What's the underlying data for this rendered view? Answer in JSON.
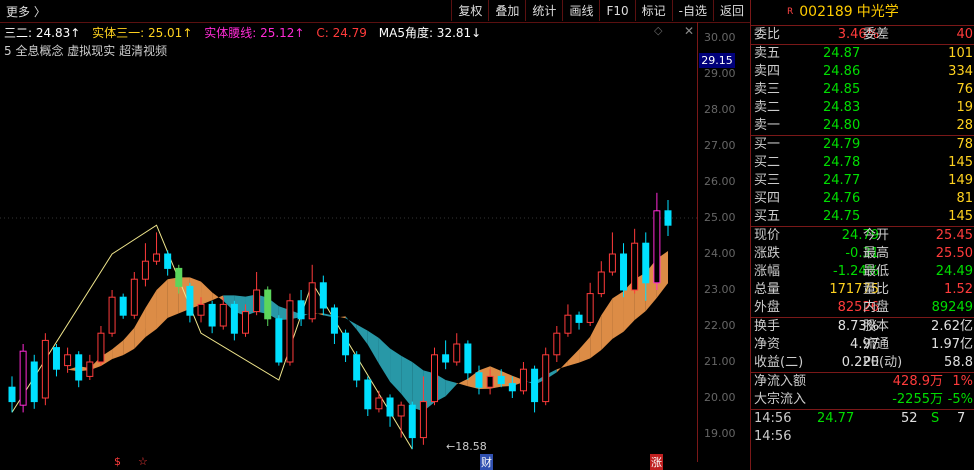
{
  "toolbar": {
    "more": "更多 〉",
    "buttons": [
      "复权",
      "叠加",
      "统计",
      "画线",
      "F10",
      "标记",
      "-自选",
      "返回"
    ]
  },
  "indicator": {
    "items": [
      {
        "text": "三二: 24.83↑",
        "color": "#ffffff"
      },
      {
        "text": "实体三一: 25.01↑",
        "color": "#ffd21f"
      },
      {
        "text": "实体腰线: 25.12↑",
        "color": "#ff2bd6"
      },
      {
        "text": "C: 24.79",
        "color": "#ff3b3b"
      },
      {
        "text": "MA5角度: 32.81↓",
        "color": "#ffffff"
      }
    ],
    "concepts": "5 全息概念 虚拟现实 超清视频"
  },
  "axis": {
    "ticks": [
      "30.00",
      "29.00",
      "28.00",
      "27.00",
      "26.00",
      "25.00",
      "24.00",
      "23.00",
      "22.00",
      "21.00",
      "20.00",
      "19.00"
    ],
    "current": "29.15"
  },
  "chart_data": {
    "type": "candlestick",
    "low_label": "←18.58",
    "markers": [
      "$",
      "☆",
      "财",
      "涨"
    ],
    "ylim": [
      18.4,
      30.4
    ],
    "candles": [
      [
        20.3,
        19.9,
        20.6,
        19.6
      ],
      [
        19.8,
        21.3,
        21.5,
        19.6
      ],
      [
        21.0,
        19.9,
        21.2,
        19.7
      ],
      [
        20.0,
        21.6,
        21.8,
        19.8
      ],
      [
        21.4,
        20.8,
        21.5,
        20.6
      ],
      [
        20.9,
        21.2,
        21.4,
        20.7
      ],
      [
        21.2,
        20.5,
        21.3,
        20.3
      ],
      [
        20.6,
        21.0,
        21.2,
        20.5
      ],
      [
        21.0,
        21.8,
        22.0,
        20.9
      ],
      [
        21.8,
        22.8,
        23.0,
        21.7
      ],
      [
        22.8,
        22.3,
        22.9,
        22.2
      ],
      [
        22.3,
        23.3,
        23.5,
        22.2
      ],
      [
        23.3,
        23.8,
        24.3,
        23.1
      ],
      [
        23.8,
        24.0,
        24.6,
        23.7
      ],
      [
        24.0,
        23.6,
        24.1,
        23.4
      ],
      [
        23.6,
        23.1,
        23.7,
        22.9
      ],
      [
        23.1,
        22.3,
        23.2,
        22.1
      ],
      [
        22.3,
        22.6,
        22.8,
        22.1
      ],
      [
        22.6,
        22.0,
        22.7,
        21.8
      ],
      [
        22.0,
        22.6,
        22.8,
        21.9
      ],
      [
        22.6,
        21.8,
        22.7,
        21.6
      ],
      [
        21.8,
        22.4,
        22.6,
        21.7
      ],
      [
        22.4,
        23.0,
        23.5,
        22.3
      ],
      [
        23.0,
        22.2,
        23.1,
        22.0
      ],
      [
        22.2,
        21.0,
        22.3,
        20.9
      ],
      [
        21.0,
        22.7,
        22.9,
        20.9
      ],
      [
        22.7,
        22.2,
        23.0,
        22.0
      ],
      [
        22.2,
        23.2,
        23.7,
        22.1
      ],
      [
        23.2,
        22.5,
        23.4,
        22.3
      ],
      [
        22.5,
        21.8,
        22.6,
        21.5
      ],
      [
        21.8,
        21.2,
        21.9,
        21.0
      ],
      [
        21.2,
        20.5,
        21.3,
        20.3
      ],
      [
        20.5,
        19.7,
        20.6,
        19.5
      ],
      [
        19.7,
        20.0,
        20.2,
        19.6
      ],
      [
        20.0,
        19.5,
        20.1,
        19.2
      ],
      [
        19.5,
        19.8,
        19.9,
        18.9
      ],
      [
        19.8,
        18.9,
        19.9,
        18.58
      ],
      [
        18.9,
        19.9,
        20.6,
        18.7
      ],
      [
        19.9,
        21.2,
        21.4,
        19.8
      ],
      [
        21.2,
        21.0,
        21.6,
        20.8
      ],
      [
        21.0,
        21.5,
        21.8,
        20.9
      ],
      [
        21.5,
        20.7,
        21.6,
        20.5
      ],
      [
        20.7,
        20.3,
        20.9,
        20.1
      ],
      [
        20.3,
        20.6,
        20.8,
        20.1
      ],
      [
        20.6,
        20.4,
        20.8,
        20.3
      ],
      [
        20.4,
        20.2,
        20.6,
        20.0
      ],
      [
        20.2,
        20.8,
        21.0,
        20.1
      ],
      [
        20.8,
        19.9,
        20.9,
        19.6
      ],
      [
        19.9,
        21.2,
        21.4,
        19.8
      ],
      [
        21.2,
        21.8,
        22.0,
        21.0
      ],
      [
        21.8,
        22.3,
        22.6,
        21.7
      ],
      [
        22.3,
        22.1,
        22.4,
        21.9
      ],
      [
        22.1,
        22.9,
        23.2,
        22.0
      ],
      [
        22.9,
        23.5,
        23.8,
        22.8
      ],
      [
        23.5,
        24.0,
        24.6,
        23.4
      ],
      [
        24.0,
        23.0,
        24.3,
        22.8
      ],
      [
        23.0,
        24.3,
        24.7,
        22.9
      ],
      [
        24.3,
        23.2,
        24.6,
        22.7
      ],
      [
        23.2,
        25.2,
        25.7,
        23.0
      ],
      [
        25.2,
        24.8,
        25.5,
        24.5
      ]
    ]
  },
  "sidebar": {
    "code": "002189",
    "name": "中光学",
    "flag": "R",
    "weibi": {
      "l": "委比",
      "v": "3.46%",
      "l2": "委差",
      "v2": "40"
    },
    "sell": [
      {
        "l": "卖五",
        "p": "24.87",
        "q": "101"
      },
      {
        "l": "卖四",
        "p": "24.86",
        "q": "334"
      },
      {
        "l": "卖三",
        "p": "24.85",
        "q": "76"
      },
      {
        "l": "卖二",
        "p": "24.83",
        "q": "19"
      },
      {
        "l": "卖一",
        "p": "24.80",
        "q": "28"
      }
    ],
    "buy": [
      {
        "l": "买一",
        "p": "24.79",
        "q": "78"
      },
      {
        "l": "买二",
        "p": "24.78",
        "q": "145"
      },
      {
        "l": "买三",
        "p": "24.77",
        "q": "149"
      },
      {
        "l": "买四",
        "p": "24.76",
        "q": "81"
      },
      {
        "l": "买五",
        "p": "24.75",
        "q": "145"
      }
    ],
    "quote": [
      {
        "l": "现价",
        "v": "24.79",
        "c": "g",
        "l2": "今开",
        "v2": "25.45",
        "c2": "rd"
      },
      {
        "l": "涨跌",
        "v": "-0.31",
        "c": "g",
        "l2": "最高",
        "v2": "25.50",
        "c2": "rd"
      },
      {
        "l": "涨幅",
        "v": "-1.24%",
        "c": "g",
        "l2": "最低",
        "v2": "24.49",
        "c2": "g"
      },
      {
        "l": "总量",
        "v": "171775",
        "c": "y",
        "l2": "量比",
        "v2": "1.52",
        "c2": "rd"
      },
      {
        "l": "外盘",
        "v": "82526",
        "c": "rd",
        "l2": "内盘",
        "v2": "89249",
        "c2": "g"
      }
    ],
    "stats": [
      {
        "l": "换手",
        "v": "8.73%",
        "l2": "股本",
        "v2": "2.62亿"
      },
      {
        "l": "净资",
        "v": "4.97",
        "l2": "流通",
        "v2": "1.97亿"
      },
      {
        "l": "收益(二)",
        "v": "0.220",
        "l2": "PE(动)",
        "v2": "58.8"
      }
    ],
    "flow": [
      {
        "l": "净流入额",
        "v": "428.9万",
        "v2": "1%"
      },
      {
        "l": "大宗流入",
        "v": "-2255万",
        "v2": "-5%"
      }
    ],
    "ticks": [
      {
        "t": "14:56",
        "p": "24.77",
        "q": "52",
        "s": "S",
        "n": "7"
      },
      {
        "t": "14:56",
        "p": "",
        "q": "",
        "s": "",
        "n": ""
      }
    ]
  }
}
